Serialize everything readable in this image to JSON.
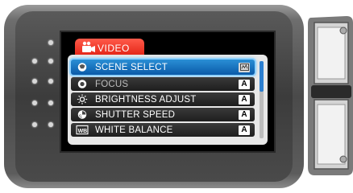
{
  "menu": {
    "tab_label": "VIDEO",
    "items": [
      {
        "label": "SCENE SELECT",
        "icon": "scene-select-icon",
        "badge": "",
        "selected": true
      },
      {
        "label": "FOCUS",
        "icon": "focus-icon",
        "badge": "A",
        "selected": false
      },
      {
        "label": "BRIGHTNESS ADJUST",
        "icon": "brightness-icon",
        "badge": "A",
        "selected": false
      },
      {
        "label": "SHUTTER SPEED",
        "icon": "shutter-speed-icon",
        "badge": "A",
        "selected": false
      },
      {
        "label": "WHITE BALANCE",
        "icon": "white-balance-icon",
        "badge": "A",
        "selected": false
      }
    ],
    "scroll_position": 0.0
  },
  "colors": {
    "tab": "#e01e10",
    "selection": "#1a75c4",
    "selection_glow": "#8fd2ff"
  }
}
